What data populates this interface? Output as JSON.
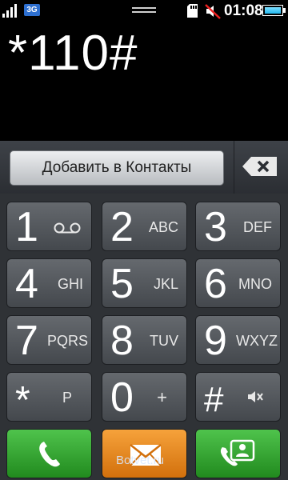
{
  "status": {
    "network": "3G",
    "time": "01:08",
    "battery_level": 1.0
  },
  "display": {
    "number": "*110#"
  },
  "actions": {
    "add_contact_label": "Добавить в Контакты"
  },
  "keys": [
    {
      "digit": "1",
      "letters": ""
    },
    {
      "digit": "2",
      "letters": "ABC"
    },
    {
      "digit": "3",
      "letters": "DEF"
    },
    {
      "digit": "4",
      "letters": "GHI"
    },
    {
      "digit": "5",
      "letters": "JKL"
    },
    {
      "digit": "6",
      "letters": "MNO"
    },
    {
      "digit": "7",
      "letters": "PQRS"
    },
    {
      "digit": "8",
      "letters": "TUV"
    },
    {
      "digit": "9",
      "letters": "WXYZ"
    },
    {
      "digit": "*",
      "letters": "P"
    },
    {
      "digit": "0",
      "letters": "+"
    },
    {
      "digit": "#",
      "letters": ""
    }
  ],
  "icons": {
    "key_1_secondary": "voicemail-icon",
    "key_hash_secondary": "mute-icon",
    "backspace": "backspace-icon",
    "call": "phone-icon",
    "message": "envelope-icon",
    "video_call": "video-call-icon"
  },
  "colors": {
    "call_green": "#2fa32c",
    "message_orange": "#e9891f",
    "network_badge_blue": "#2d6fd0"
  },
  "watermark": "Botvet.ru"
}
